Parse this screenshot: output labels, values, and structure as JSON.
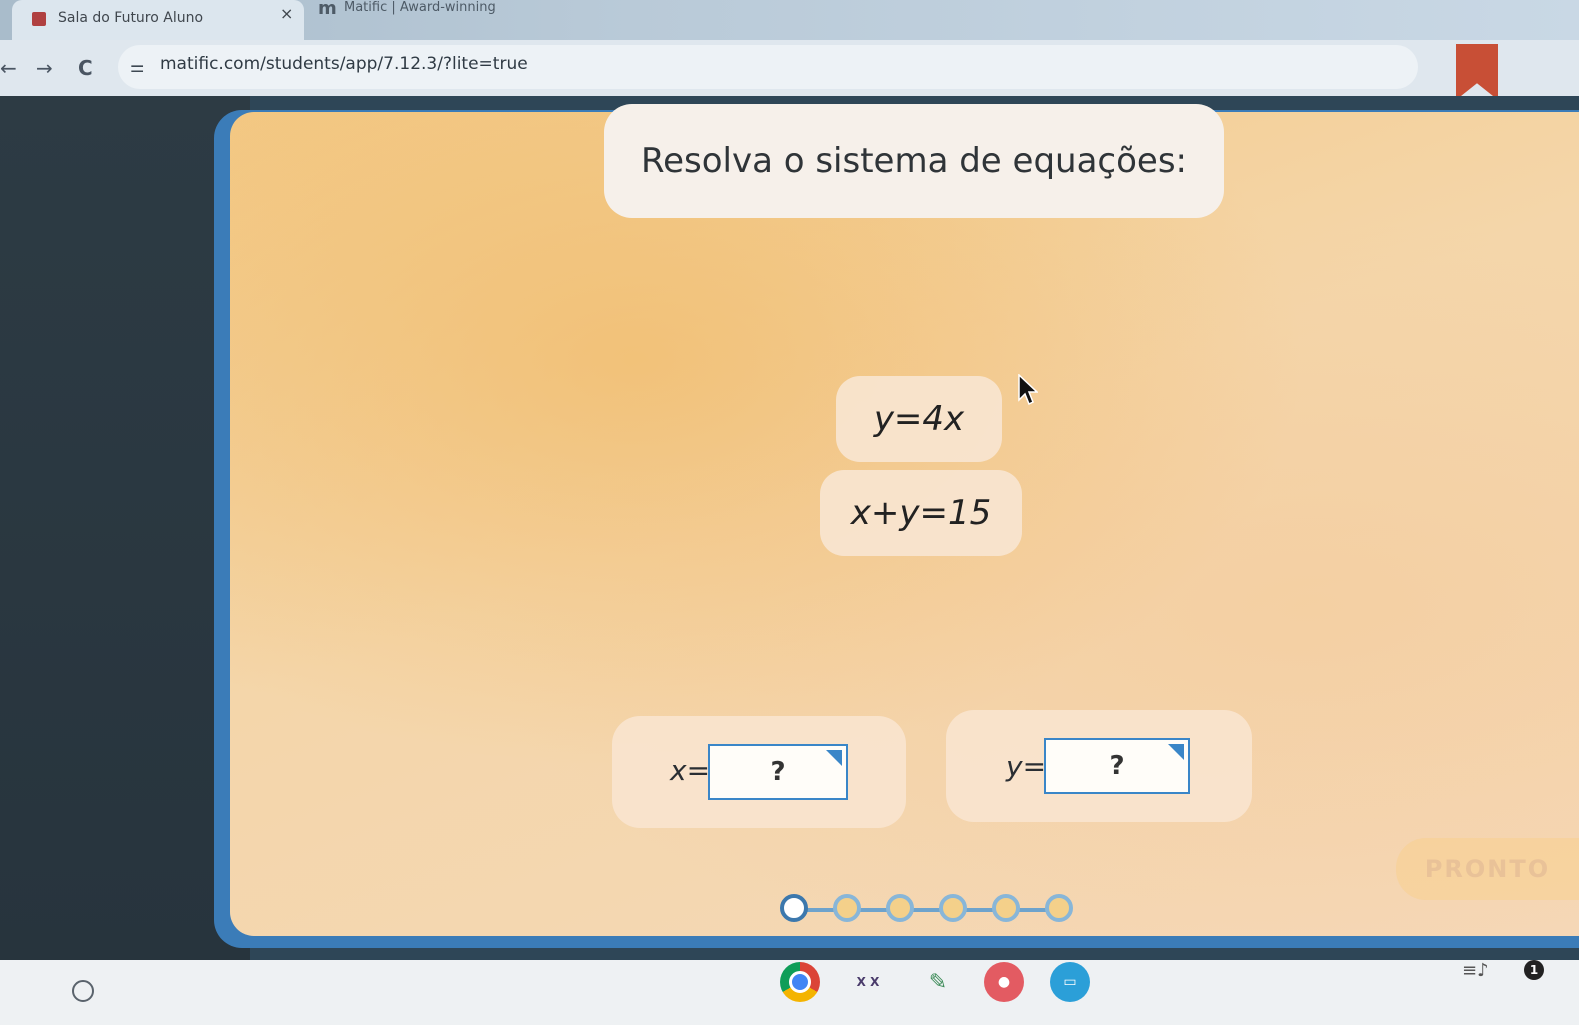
{
  "browser": {
    "active_tab_title": "Sala do Futuro Aluno",
    "inactive_tab_title": "Matific | Award-winning",
    "inactive_tab_icon": "m",
    "close_glyph": "×",
    "url": "matific.com/students/app/7.12.3/?lite=true",
    "back_glyph": "←",
    "forward_glyph": "→",
    "reload_glyph": "C",
    "site_info_glyph": "⚌"
  },
  "activity": {
    "instruction": "Resolva o sistema de equações:",
    "equations": [
      "y=4x",
      "x+y=15"
    ],
    "answers": [
      {
        "label": "x=",
        "value": "?"
      },
      {
        "label": "y=",
        "value": "?"
      }
    ],
    "done_button": "PRONTO",
    "progress": {
      "total_steps": 6,
      "current_step": 1
    }
  },
  "shelf": {
    "math_app_glyph": "X X",
    "graph_app_glyph": "✎",
    "pin_app_glyph": "●",
    "tv_app_glyph": "▭",
    "status_glyph": "≡♪",
    "notification_count": "1"
  },
  "colors": {
    "accent_blue": "#3a86c8",
    "bookmark_red": "#c84f36",
    "panel_orange": "#f3c986"
  }
}
